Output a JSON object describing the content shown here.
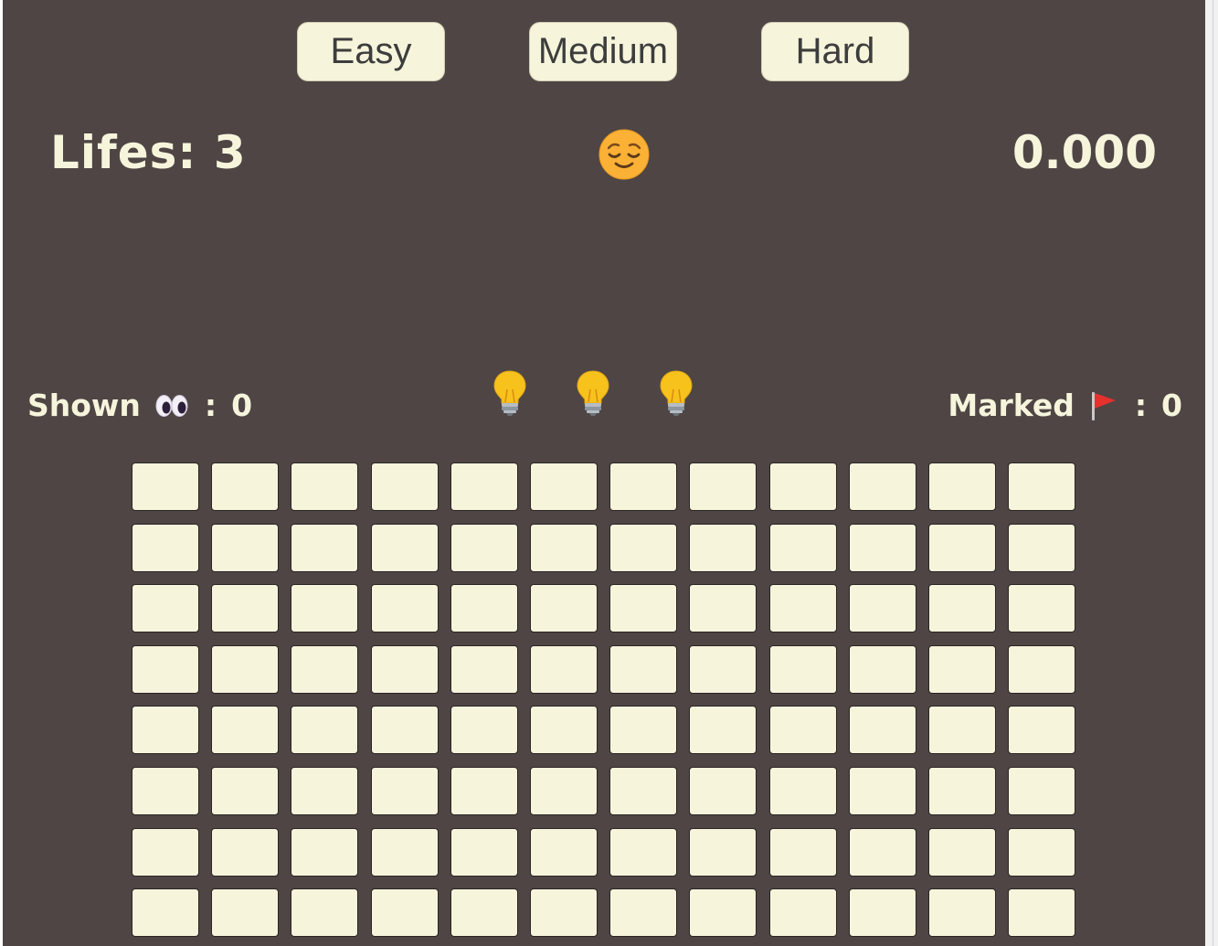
{
  "difficulty": {
    "easy": "Easy",
    "medium": "Medium",
    "hard": "Hard"
  },
  "status": {
    "lives_label": "Lifes:",
    "lives_value": "3",
    "timer": "0.000",
    "face_icon": "relieved-face-icon"
  },
  "stats": {
    "shown_label": "Shown",
    "shown_icon": "eyes-icon",
    "shown_value": "0",
    "marked_label": "Marked",
    "marked_icon": "red-flag-icon",
    "marked_value": "0",
    "colon": ":"
  },
  "hints": {
    "count": 3,
    "icon": "light-bulb-icon"
  },
  "board": {
    "columns": 12,
    "visible_rows": 8,
    "cell_state": "hidden"
  },
  "colors": {
    "background": "#4e4544",
    "cell": "#f6f5dc",
    "text": "#f6f5dc",
    "face": "#fbb036",
    "flag": "#e8302c"
  }
}
